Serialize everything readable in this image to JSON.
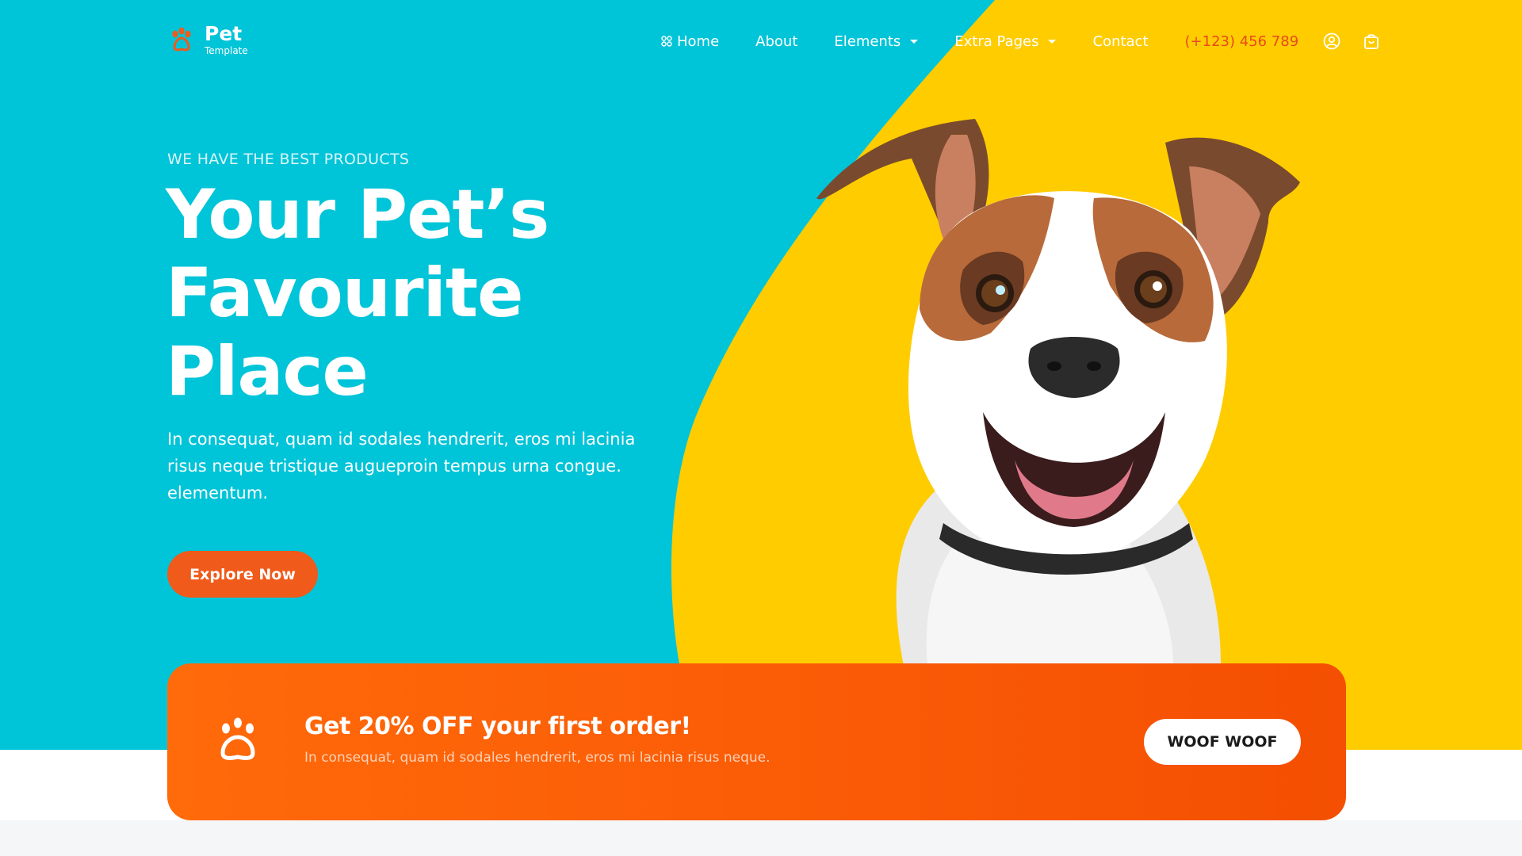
{
  "brand": {
    "name": "Pet",
    "tagline": "Template"
  },
  "nav": {
    "items": [
      {
        "label": "Home",
        "icon": "grid-icon"
      },
      {
        "label": "About"
      },
      {
        "label": "Elements",
        "dropdown": true
      },
      {
        "label": "Extra Pages",
        "dropdown": true
      },
      {
        "label": "Contact"
      }
    ],
    "phone": "(+123) 456 789",
    "icons": [
      "user-icon",
      "shopping-bag-icon"
    ]
  },
  "hero": {
    "eyebrow": "WE HAVE THE BEST PRODUCTS",
    "headline_lines": [
      "Your Pet’s",
      "Favourite",
      "Place"
    ],
    "lead": "In consequat, quam id sodales hendrerit, eros mi lacinia risus neque tristique augueproin tempus urna congue. elementum.",
    "cta": "Explore Now"
  },
  "promo": {
    "title": "Get 20% OFF your first order!",
    "text": "In consequat, quam id sodales hendrerit, eros mi lacinia risus neque.",
    "button": "WOOF WOOF",
    "icon": "paw-icon"
  },
  "colors": {
    "cyan": "#00c4d8",
    "yellow": "#ffcc00",
    "orange": "#f05a1a",
    "phone": "#e84a1b"
  }
}
